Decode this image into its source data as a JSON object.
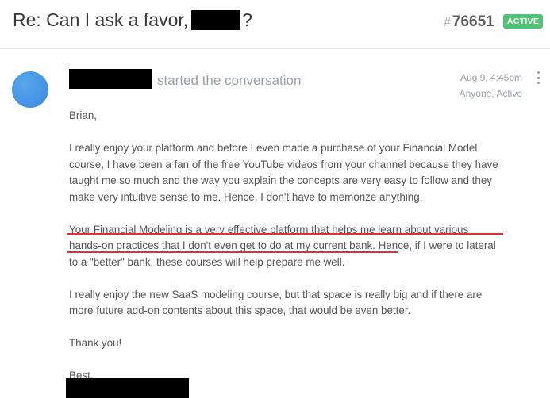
{
  "header": {
    "title_prefix": "Re: Can I ask a favor,",
    "title_suffix": "?",
    "ticket_hash": "#",
    "ticket_number": "76651",
    "status": "ACTIVE"
  },
  "message": {
    "started_text": "started the conversation",
    "date": "Aug 9, 4:45pm",
    "visibility": "Anyone, Active",
    "greeting": "Brian,",
    "para1": [
      "I really enjoy your platform and before I even made a purchase of your Financial Model",
      "course, I have been a fan of the free YouTube videos from your channel because they have",
      "taught me so much and the way you explain the concepts are very easy to follow and they",
      "make very intuitive sense to me. Hence, I don't have to memorize anything."
    ],
    "para2": [
      "Your Financial Modeling is a very effective platform that helps me learn about various",
      "hands-on practices that I don't even get to do at my current bank. Hence, if I were to lateral",
      "to a \"better\" bank, these courses will help prepare me well."
    ],
    "para3": [
      "I really enjoy the new SaaS modeling course, but that space is really big and if there are",
      "more future add-on contents about this space, that would be even better."
    ],
    "thanks": "Thank you!",
    "closing": "Best,"
  },
  "colors": {
    "status_badge": "#4fc275",
    "avatar": "#3e8fe3",
    "underline": "#d9323a"
  }
}
